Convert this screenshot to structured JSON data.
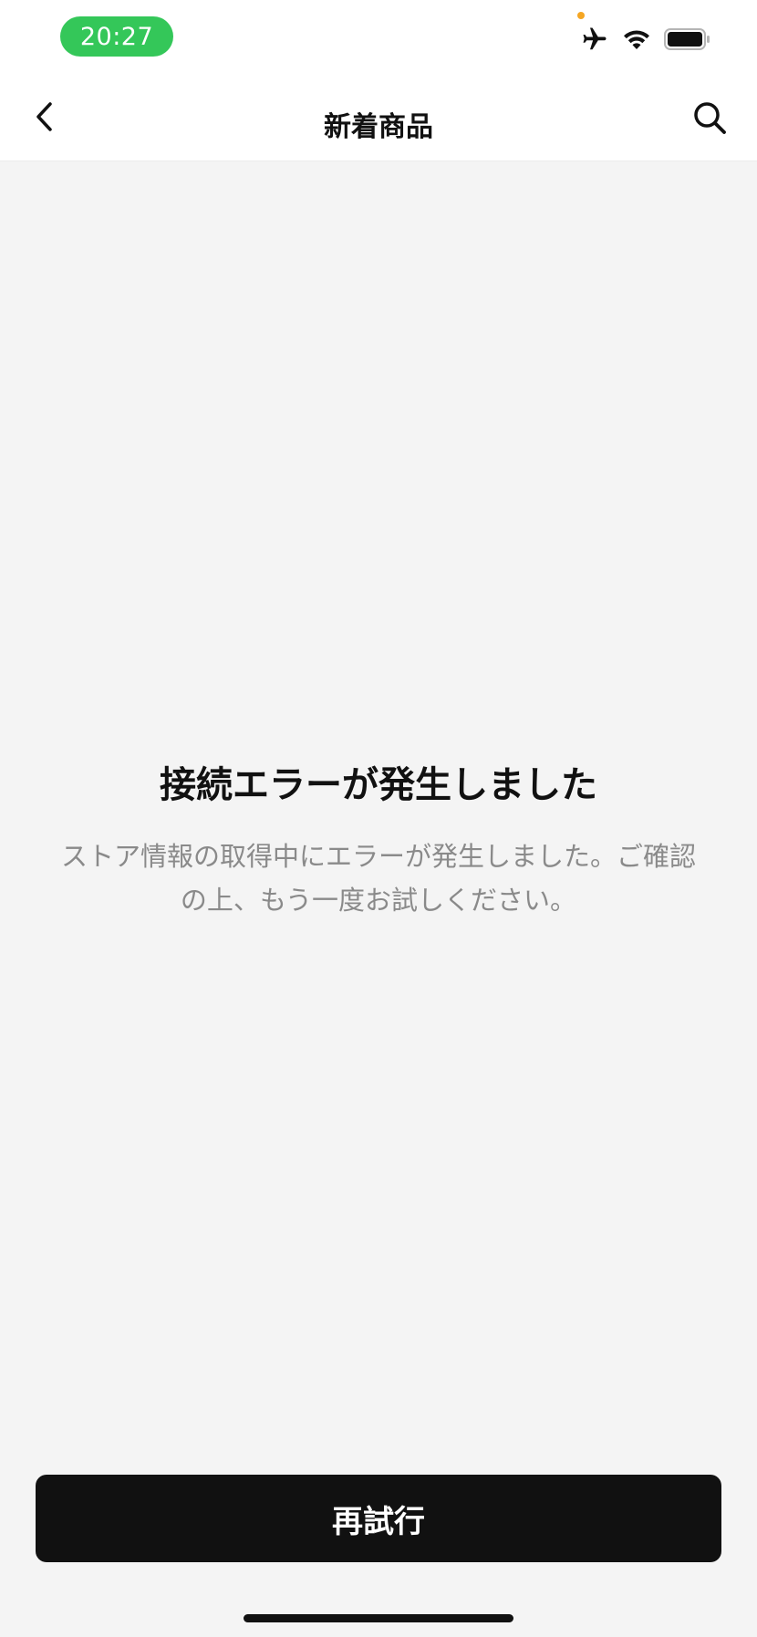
{
  "status_bar": {
    "time": "20:27",
    "icons": [
      "airplane-icon",
      "wifi-icon",
      "battery-icon"
    ],
    "accent_color": "#34c759",
    "privacy_dot_color": "#f5a623"
  },
  "nav": {
    "title": "新着商品",
    "back_icon": "chevron-left-icon",
    "search_icon": "search-icon"
  },
  "error": {
    "title": "接続エラーが発生しました",
    "message_line1": "ストア情報の取得中にエラーが発生しました。ご確認",
    "message_line2": "の上、もう一度お試しください。"
  },
  "actions": {
    "retry_label": "再試行"
  }
}
